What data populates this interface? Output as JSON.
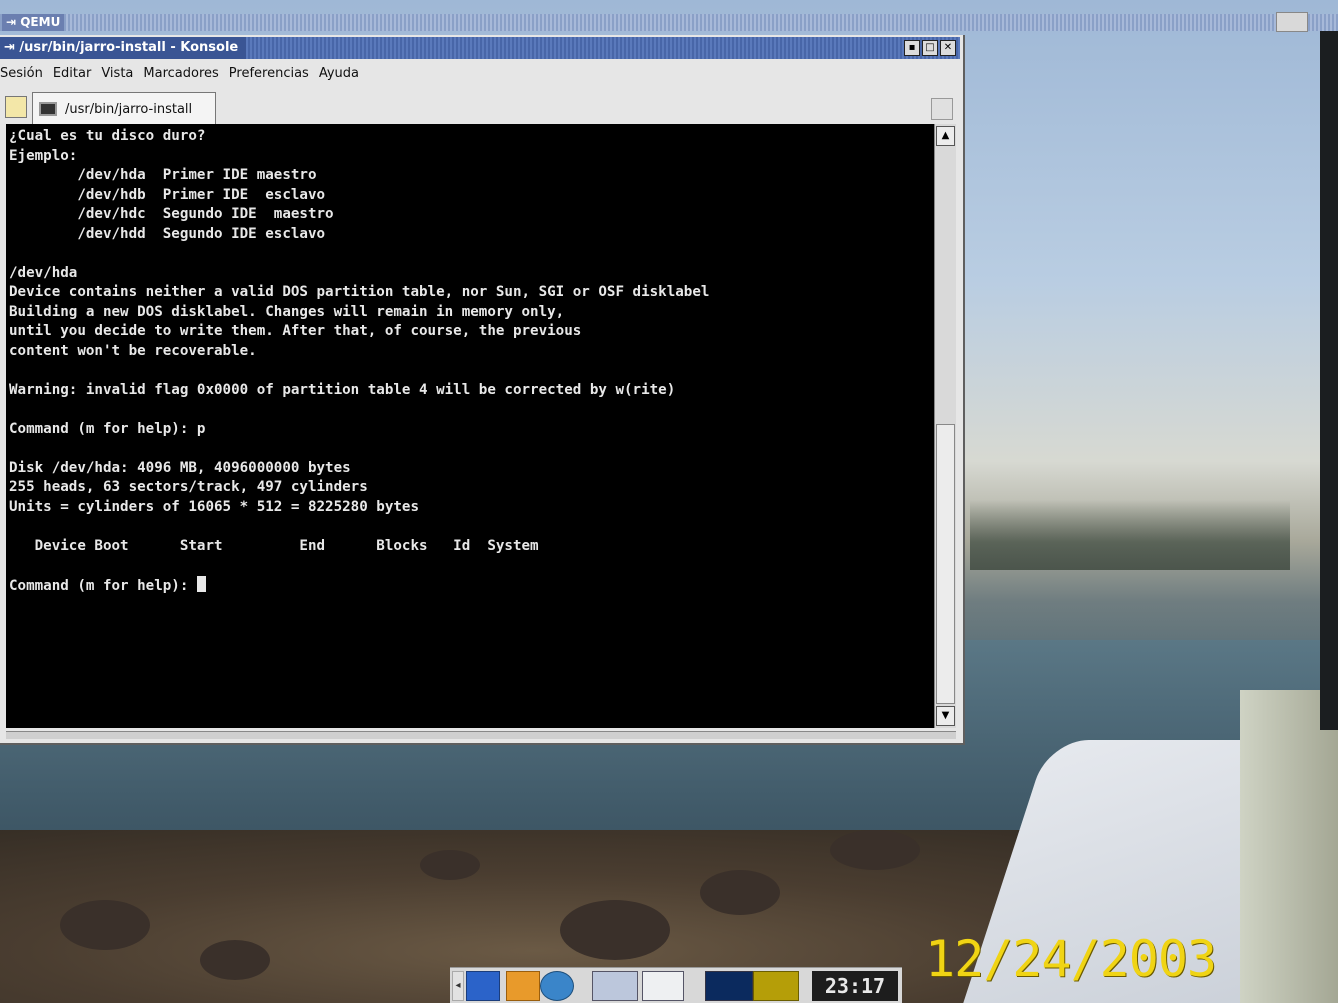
{
  "qemu": {
    "title": "QEMU"
  },
  "konsole": {
    "title": "/usr/bin/jarro-install - Konsole",
    "menu": [
      "Sesión",
      "Editar",
      "Vista",
      "Marcadores",
      "Preferencias",
      "Ayuda"
    ],
    "tab_label": "/usr/bin/jarro-install",
    "terminal_lines": [
      "¿Cual es tu disco duro?",
      "Ejemplo:",
      "        /dev/hda  Primer IDE maestro",
      "        /dev/hdb  Primer IDE  esclavo",
      "        /dev/hdc  Segundo IDE  maestro",
      "        /dev/hdd  Segundo IDE esclavo",
      "",
      "/dev/hda",
      "Device contains neither a valid DOS partition table, nor Sun, SGI or OSF disklabel",
      "Building a new DOS disklabel. Changes will remain in memory only,",
      "until you decide to write them. After that, of course, the previous",
      "content won't be recoverable.",
      "",
      "Warning: invalid flag 0x0000 of partition table 4 will be corrected by w(rite)",
      "",
      "Command (m for help): p",
      "",
      "Disk /dev/hda: 4096 MB, 4096000000 bytes",
      "255 heads, 63 sectors/track, 497 cylinders",
      "Units = cylinders of 16065 * 512 = 8225280 bytes",
      "",
      "   Device Boot      Start         End      Blocks   Id  System",
      ""
    ],
    "prompt": "Command (m for help): "
  },
  "taskbar": {
    "clock": "23:17"
  },
  "desktop": {
    "date_stamp": "12/24/2003"
  }
}
